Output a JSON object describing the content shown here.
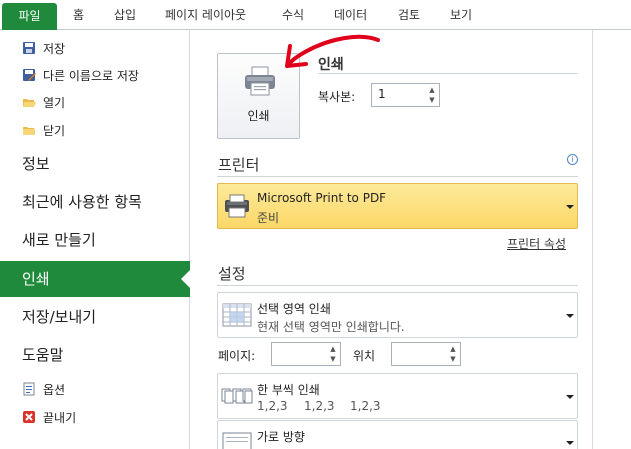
{
  "ribbon": {
    "tabs": [
      "파일",
      "홈",
      "삽입",
      "페이지 레이아웃",
      "수식",
      "데이터",
      "검토",
      "보기"
    ]
  },
  "nav": {
    "small_items_top": [
      {
        "label": "저장",
        "icon": "save-icon"
      },
      {
        "label": "다른 이름으로 저장",
        "icon": "save-as-icon"
      },
      {
        "label": "열기",
        "icon": "open-folder-icon"
      },
      {
        "label": "닫기",
        "icon": "close-folder-icon"
      }
    ],
    "large_items": [
      "정보",
      "최근에 사용한 항목",
      "새로 만들기",
      "인쇄",
      "저장/보내기",
      "도움말"
    ],
    "active": "인쇄",
    "small_items_bottom": [
      {
        "label": "옵션",
        "icon": "options-icon"
      },
      {
        "label": "끝내기",
        "icon": "exit-icon"
      }
    ]
  },
  "print": {
    "section_title": "인쇄",
    "button_label": "인쇄",
    "copies_label": "복사본:",
    "copies_value": "1"
  },
  "printer": {
    "header": "프린터",
    "name": "Microsoft Print to PDF",
    "status": "준비",
    "properties_link": "프린터 속성",
    "info_icon": "info-icon"
  },
  "settings": {
    "header": "설정",
    "print_what": {
      "title": "선택 영역 인쇄",
      "desc": "현재 선택 영역만 인쇄합니다."
    },
    "pages_label": "페이지:",
    "pages_value": "",
    "to_label": "위치",
    "to_value": "",
    "collate": {
      "title": "한 부씩 인쇄",
      "desc": [
        "1,2,3",
        "1,2,3",
        "1,2,3"
      ]
    },
    "orientation": {
      "title": "가로 방향"
    }
  },
  "colors": {
    "accent": "#1f8a3c",
    "printer_highlight": "#fbd867",
    "annotation_arrow": "#e0001b"
  }
}
